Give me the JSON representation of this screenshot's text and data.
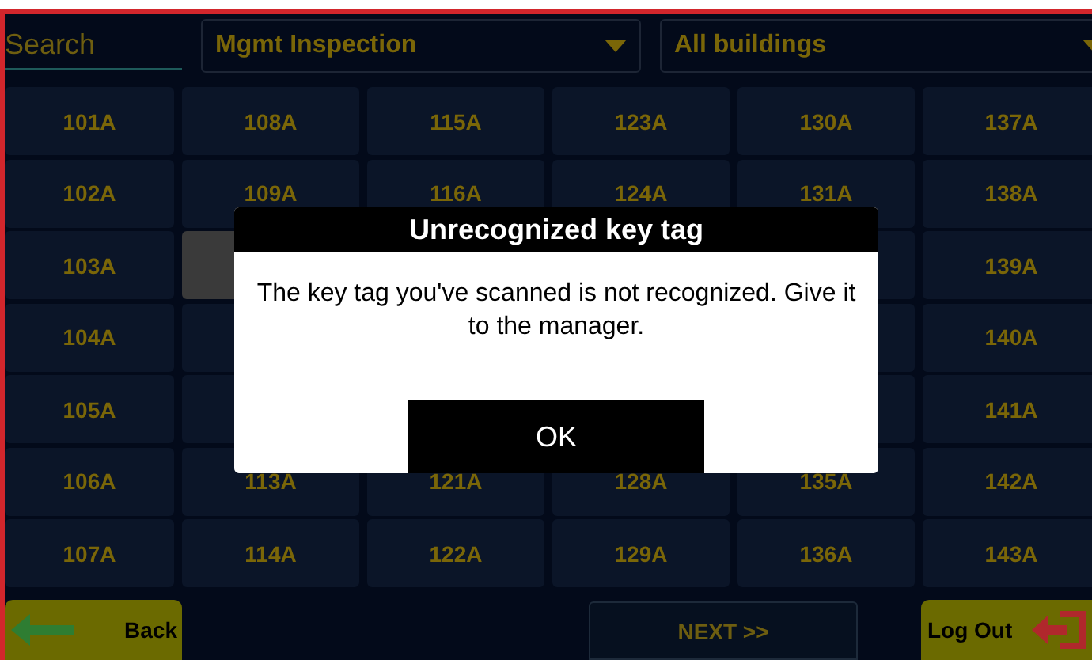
{
  "search": {
    "placeholder": "Search"
  },
  "filters": [
    {
      "label": "Mgmt Inspection"
    },
    {
      "label": "All buildings"
    }
  ],
  "grid": [
    [
      {
        "label": "101A",
        "selected": false
      },
      {
        "label": "108A",
        "selected": false
      },
      {
        "label": "115A",
        "selected": false
      },
      {
        "label": "123A",
        "selected": false
      },
      {
        "label": "130A",
        "selected": false
      },
      {
        "label": "137A",
        "selected": false
      }
    ],
    [
      {
        "label": "102A",
        "selected": false
      },
      {
        "label": "109A",
        "selected": false
      },
      {
        "label": "116A",
        "selected": false
      },
      {
        "label": "124A",
        "selected": false
      },
      {
        "label": "131A",
        "selected": false
      },
      {
        "label": "138A",
        "selected": false
      }
    ],
    [
      {
        "label": "103A",
        "selected": false
      },
      {
        "selected": true
      },
      {
        "selected": false
      },
      {
        "label": "139A",
        "selected": false
      }
    ],
    [
      {
        "label": "104A",
        "selected": false
      },
      {
        "selected": false
      },
      {
        "selected": false
      },
      {
        "label": "140A",
        "selected": false
      }
    ],
    [
      {
        "label": "105A",
        "selected": false
      },
      {
        "selected": false
      },
      {
        "selected": false
      },
      {
        "label": "141A",
        "selected": false
      }
    ],
    [
      {
        "label": "106A",
        "selected": false
      },
      {
        "label": "113A",
        "selected": false
      },
      {
        "label": "121A",
        "selected": false
      },
      {
        "label": "128A",
        "selected": false
      },
      {
        "label": "135A",
        "selected": false
      },
      {
        "label": "142A",
        "selected": false
      }
    ],
    [
      {
        "label": "107A",
        "selected": false
      },
      {
        "label": "114A",
        "selected": false
      },
      {
        "label": "122A",
        "selected": false
      },
      {
        "label": "129A",
        "selected": false
      },
      {
        "label": "136A",
        "selected": false
      },
      {
        "label": "143A",
        "selected": false
      }
    ]
  ],
  "footer": {
    "back": "Back",
    "next": "NEXT >>",
    "logout": "Log Out"
  },
  "dialog": {
    "title": "Unrecognized key tag",
    "message": "The key tag you've scanned is not recognized. Give it to the manager.",
    "button": "OK"
  }
}
